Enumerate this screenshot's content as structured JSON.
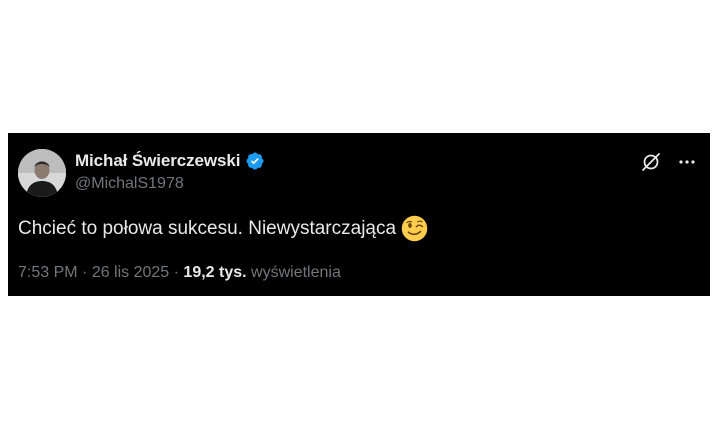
{
  "tweet": {
    "author": {
      "display_name": "Michał Świerczewski",
      "handle": "@MichalS1978",
      "verified": true,
      "verified_color": "#1d9bf0"
    },
    "text": "Chcieć to połowa sukcesu. Niewystarczająca",
    "emoji": "winking-face-icon",
    "meta": {
      "time": "7:53 PM",
      "separator1": " · ",
      "date": "26 lis 2025",
      "separator2": " · ",
      "views_count": "19,2 tys.",
      "views_label": "wyświetlenia"
    },
    "actions": {
      "grok_icon": "grok-icon",
      "more_icon": "more-options-icon"
    }
  },
  "colors": {
    "card_background": "#000000",
    "page_background": "#ffffff",
    "primary_text": "#e7e9ea",
    "secondary_text": "#71767b"
  }
}
